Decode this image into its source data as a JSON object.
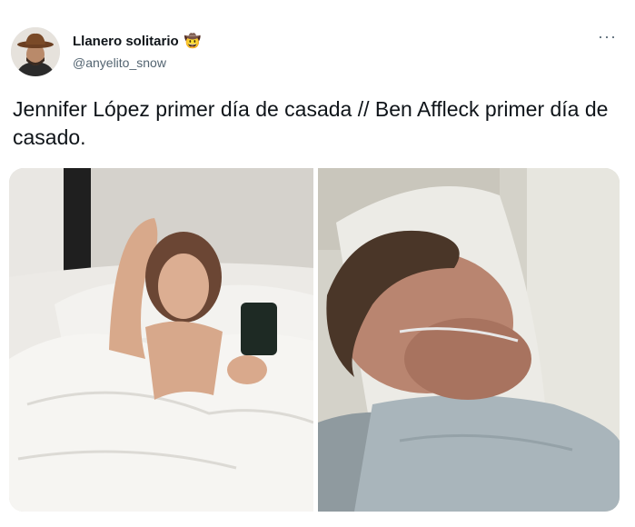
{
  "tweet": {
    "display_name": "Llanero solitario",
    "name_emoji": "🤠",
    "handle": "@anyelito_snow",
    "more_icon": "more-horizontal-icon",
    "more_glyph": "···",
    "text": "Jennifer López primer día de casada // Ben Affleck primer día de casado."
  },
  "colors": {
    "text_primary": "#0f1419",
    "text_secondary": "#536471",
    "background": "#ffffff"
  }
}
